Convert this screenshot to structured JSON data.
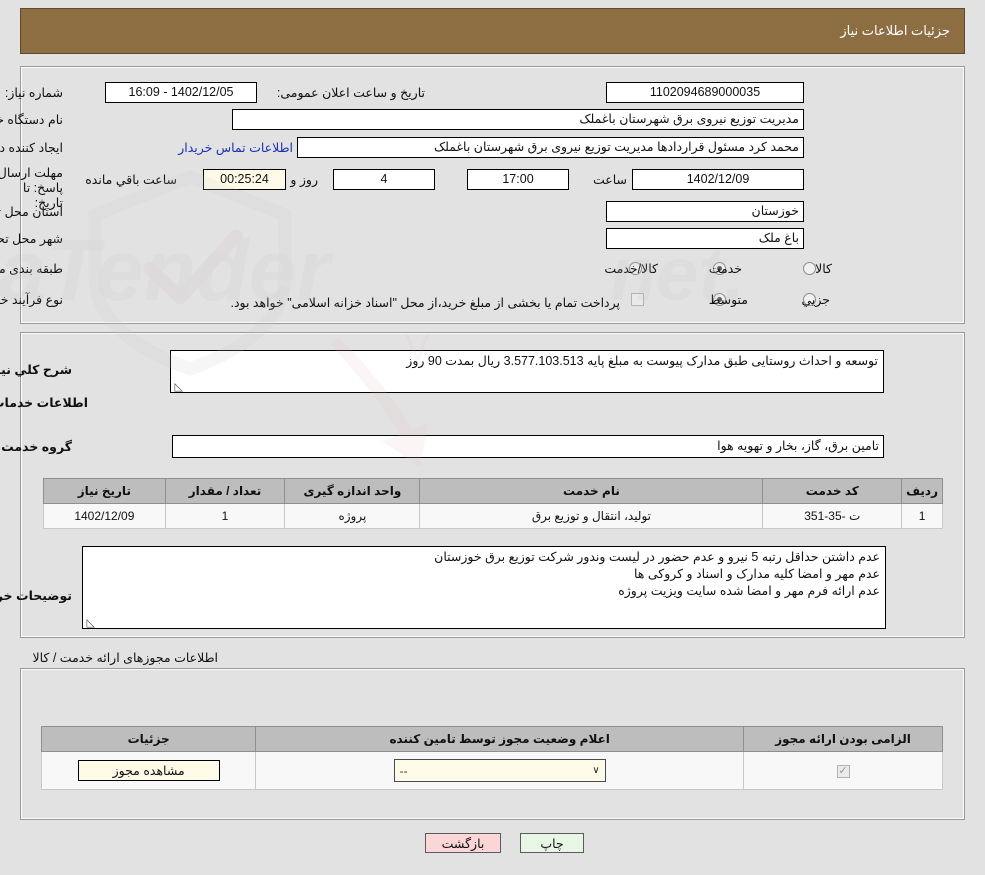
{
  "header": {
    "title": "جزئیات اطلاعات نیاز"
  },
  "need_info": {
    "need_number_label": "شماره نیاز:",
    "need_number_value": "1102094689000035",
    "announce_datetime_label": "تاریخ و ساعت اعلان عمومی:",
    "announce_datetime_value": "1402/12/05 - 16:09",
    "buyer_org_label": "نام دستگاه خریدار:",
    "buyer_org_value": "مدیریت توزیع نیروی برق شهرستان باغملک",
    "creator_label": "ایجاد کننده درخواست:",
    "creator_value": "محمد کرد مسئول قراردادها مدیریت توزیع نیروی برق شهرستان باغملک",
    "contact_link": "اطلاعات تماس خریدار",
    "deadline_label": "مهلت ارسال پاسخ: تا تاریخ:",
    "deadline_date": "1402/12/09",
    "deadline_hour_label": "ساعت",
    "deadline_hour": "17:00",
    "remaining_days": "4",
    "remaining_days_label": "روز و",
    "remaining_time": "00:25:24",
    "remaining_time_label": "ساعت باقي مانده",
    "province_label": "استان محل تحویل:",
    "province_value": "خوزستان",
    "city_label": "شهر محل تحویل:",
    "city_value": "باغ ملک",
    "classification_label": "طبقه بندی موضوعی:",
    "classification_options": [
      {
        "label": "کالا",
        "selected": false
      },
      {
        "label": "خدمت",
        "selected": true
      },
      {
        "label": "کالا/خدمت",
        "selected": false
      }
    ],
    "purchase_type_label": "نوع فرآیند خرید :",
    "purchase_type_options": [
      {
        "label": "جزیي",
        "selected": false
      },
      {
        "label": "متوسط",
        "selected": true
      }
    ],
    "treasury_checkbox_checked": false,
    "treasury_text": "پرداخت تمام یا بخشی از مبلغ خرید،از محل \"اسناد خزانه اسلامی\" خواهد بود."
  },
  "requirement": {
    "summary_label": "شرح کلي نیاز:",
    "summary_value": "توسعه و احداث روستایی طبق مدارک پیوست به مبلغ پایه 3.577.103.513 ریال بمدت 90 روز",
    "services_heading": "اطلاعات خدمات مورد نیاز",
    "service_group_label": "گروه خدمت:",
    "service_group_value": "تامین برق، گاز، بخار و تهویه هوا",
    "table": {
      "columns": [
        "ردیف",
        "کد خدمت",
        "نام خدمت",
        "واحد اندازه گیری",
        "تعداد / مقدار",
        "تاریخ نیاز"
      ],
      "rows": [
        {
          "row_no": "1",
          "service_code": "ت -35-351",
          "service_name": "تولید، انتقال و توزیع برق",
          "unit": "پروژه",
          "quantity": "1",
          "need_date": "1402/12/09"
        }
      ]
    },
    "buyer_notes_label": "توضیحات خریدار:",
    "buyer_notes_lines": [
      "عدم داشتن حداقل رتبه 5 نیرو و عدم حضور در لیست وندور شرکت توزیع برق خوزستان",
      "عدم مهر و امضا کلیه مدارک و اسناد و کروکی ها",
      "عدم ارائه فرم مهر و امضا شده سایت ویزیت پروژه"
    ]
  },
  "permits": {
    "caption": "اطلاعات مجوزهای ارائه خدمت / کالا",
    "columns": [
      "الزامی بودن ارائه مجوز",
      "اعلام وضعیت مجوز توسط تامین کننده",
      "جزئیات"
    ],
    "rows": [
      {
        "required_checked": true,
        "status_value": "--",
        "details_button": "مشاهده مجوز"
      }
    ]
  },
  "footer": {
    "print_button": "چاپ",
    "back_button": "بازگشت"
  },
  "colors": {
    "header_bar": "#8d6e43",
    "page_bg": "#e2e2e2",
    "link": "#1c30b5",
    "print_btn": "#e8f6e6",
    "back_btn": "#fbd6d6",
    "cream_field": "#fdfbe8",
    "table_header": "#bdbdbd"
  },
  "watermark": {
    "text": "AriaTender.net"
  }
}
